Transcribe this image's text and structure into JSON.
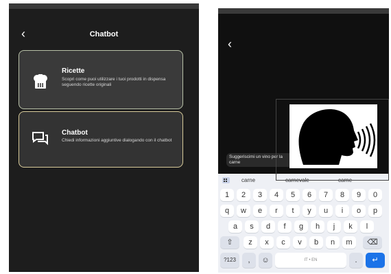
{
  "left_screen": {
    "title": "Chatbot",
    "back_icon": "chevron-left-icon",
    "cards": [
      {
        "icon": "chef-hat-icon",
        "title": "Ricette",
        "description": "Scopri come puoi utilizzare i tuoi prodotti in dispensa seguendo ricette originali"
      },
      {
        "icon": "chat-bubbles-icon",
        "title": "Chatbot",
        "description": "Chiedi informazioni aggiuntive dialogando con il chatbot"
      }
    ]
  },
  "right_screen": {
    "back_icon": "chevron-left-icon",
    "chat_message": "Suggeriscimi un vino per la carne",
    "keyboard": {
      "suggestions": [
        "carne",
        "carnevale",
        "carne"
      ],
      "rows": [
        [
          "1",
          "2",
          "3",
          "4",
          "5",
          "6",
          "7",
          "8",
          "9",
          "0"
        ],
        [
          "q",
          "w",
          "e",
          "r",
          "t",
          "y",
          "u",
          "i",
          "o",
          "p"
        ],
        [
          "a",
          "s",
          "d",
          "f",
          "g",
          "h",
          "j",
          "k",
          "l"
        ],
        [
          "z",
          "x",
          "c",
          "v",
          "b",
          "n",
          "m"
        ]
      ],
      "symbols_key": "?123",
      "comma_key": ",",
      "period_key": ".",
      "space_label": "IT • EN",
      "emoji_icon": "emoji-icon",
      "shift_icon": "shift-icon",
      "backspace_icon": "backspace-icon",
      "enter_icon": "enter-arrow-icon",
      "grid_icon": "apps-grid-icon"
    }
  },
  "overlay": {
    "icon": "speaking-head-icon"
  },
  "colors": {
    "enter_key": "#1c73e8",
    "card_border": "#b9c2a8"
  }
}
